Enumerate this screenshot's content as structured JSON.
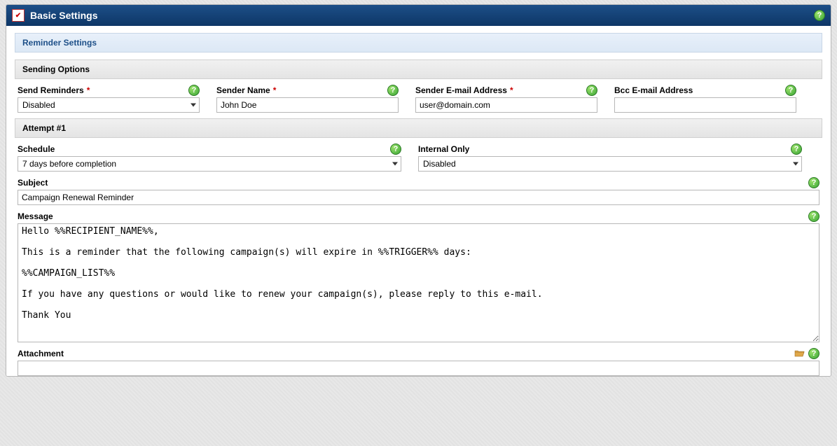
{
  "panel": {
    "title": "Basic Settings"
  },
  "section": {
    "title": "Reminder Settings"
  },
  "sending_options": {
    "title": "Sending Options",
    "send_reminders": {
      "label": "Send Reminders",
      "value": "Disabled"
    },
    "sender_name": {
      "label": "Sender Name",
      "value": "John Doe"
    },
    "sender_email": {
      "label": "Sender E-mail Address",
      "value": "user@domain.com"
    },
    "bcc_email": {
      "label": "Bcc E-mail Address",
      "value": ""
    }
  },
  "attempt1": {
    "title": "Attempt #1",
    "schedule": {
      "label": "Schedule",
      "value": "7 days before completion"
    },
    "internal_only": {
      "label": "Internal Only",
      "value": "Disabled"
    },
    "subject": {
      "label": "Subject",
      "value": "Campaign Renewal Reminder"
    },
    "message": {
      "label": "Message",
      "value": "Hello %%RECIPIENT_NAME%%,\n\nThis is a reminder that the following campaign(s) will expire in %%TRIGGER%% days:\n\n%%CAMPAIGN_LIST%%\n\nIf you have any questions or would like to renew your campaign(s), please reply to this e-mail.\n\nThank You"
    },
    "attachment": {
      "label": "Attachment",
      "value": ""
    }
  }
}
